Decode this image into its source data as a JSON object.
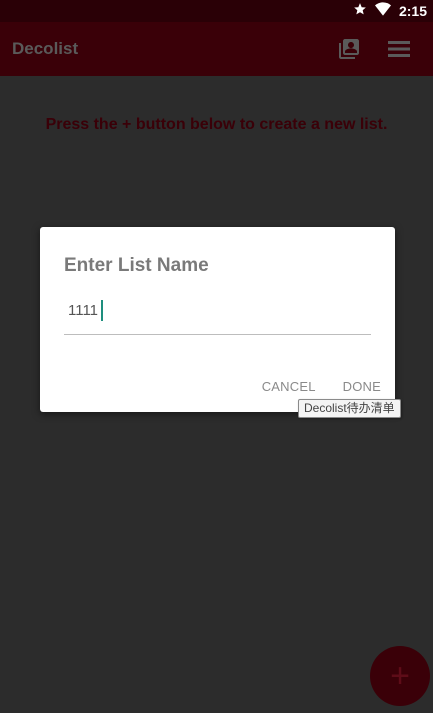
{
  "status_bar": {
    "time": "2:15",
    "icons": [
      "star-icon",
      "wifi-icon"
    ]
  },
  "app_bar": {
    "title": "Decolist",
    "icons": [
      "contacts-icon",
      "menu-icon"
    ]
  },
  "content": {
    "hint": "Press the + button below to create a new list."
  },
  "dialog": {
    "title": "Enter List Name",
    "input_value": "1111",
    "cancel_label": "CANCEL",
    "done_label": "DONE"
  },
  "tooltip": {
    "text": "Decolist待办清单"
  },
  "fab": {
    "label": "+"
  },
  "colors": {
    "status_bar": "#2a0006",
    "app_bar": "#3a0008",
    "background": "#2c2c2c",
    "caret": "#1e8e7e"
  }
}
